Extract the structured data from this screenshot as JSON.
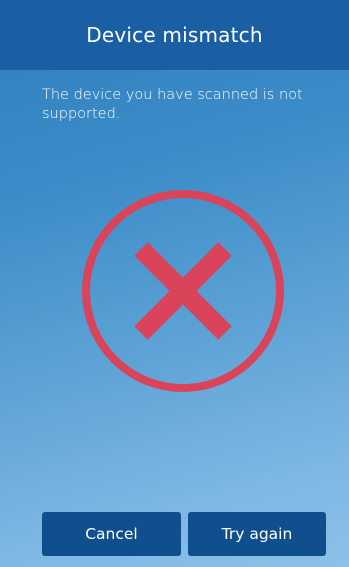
{
  "header": {
    "title": "Device mismatch"
  },
  "main": {
    "message": "The device you have scanned is not supported.",
    "icon": "error-x-icon"
  },
  "actions": {
    "cancel_label": "Cancel",
    "retry_label": "Try again"
  },
  "colors": {
    "header_bg": "#1a5fa4",
    "button_bg": "#0f4f8e",
    "error_red": "#d9445a"
  }
}
